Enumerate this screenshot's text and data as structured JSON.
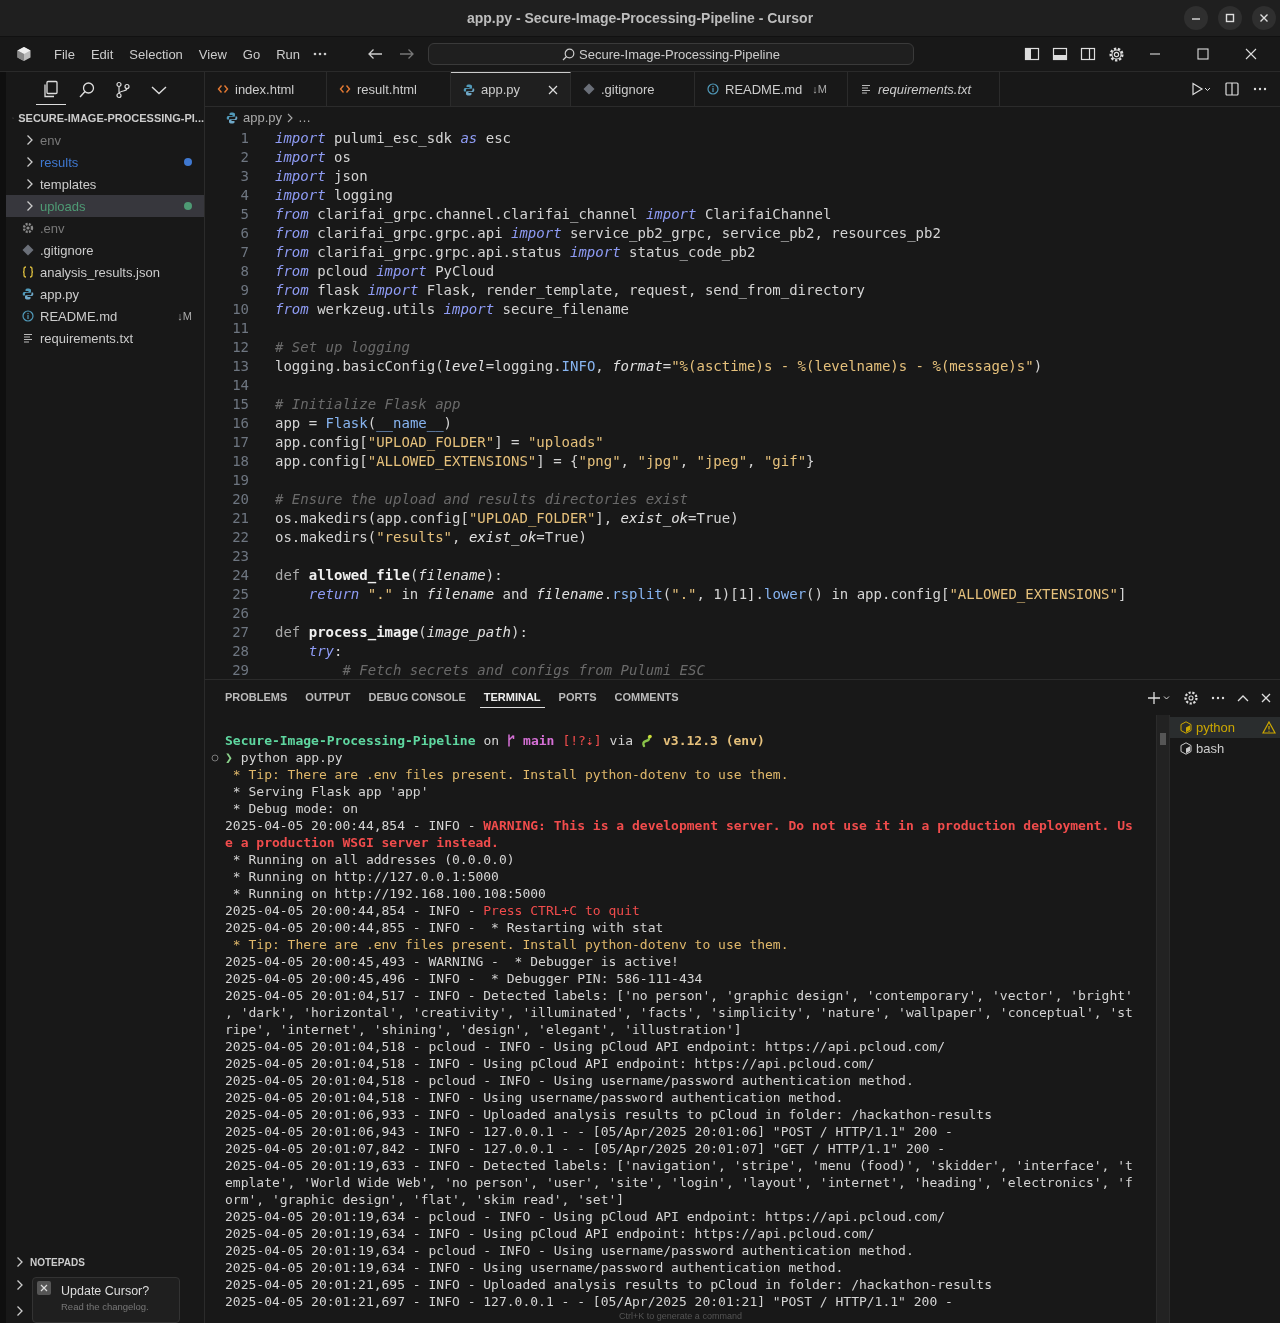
{
  "window": {
    "title": "app.py - Secure-Image-Processing-Pipeline - Cursor"
  },
  "menu": [
    "File",
    "Edit",
    "Selection",
    "View",
    "Go",
    "Run"
  ],
  "command_center": {
    "text": "Secure-Image-Processing-Pipeline"
  },
  "sidebar": {
    "title": "SECURE-IMAGE-PROCESSING-PI...",
    "tree": [
      {
        "label": "env",
        "kind": "folder",
        "ignored": true,
        "selected": false
      },
      {
        "label": "results",
        "kind": "folder",
        "ignored": false,
        "selected": false,
        "color": "#3f78d0"
      },
      {
        "label": "templates",
        "kind": "folder",
        "ignored": false,
        "selected": false
      },
      {
        "label": "uploads",
        "kind": "folder",
        "ignored": false,
        "selected": true,
        "color": "#4e9a74"
      },
      {
        "label": ".env",
        "kind": "config",
        "ignored": true,
        "selected": false
      },
      {
        "label": ".gitignore",
        "kind": "git",
        "ignored": false,
        "selected": false
      },
      {
        "label": "analysis_results.json",
        "kind": "json",
        "ignored": false,
        "selected": false
      },
      {
        "label": "app.py",
        "kind": "python",
        "ignored": false,
        "selected": false
      },
      {
        "label": "README.md",
        "kind": "info",
        "ignored": false,
        "selected": false,
        "badge": "↓M"
      },
      {
        "label": "requirements.txt",
        "kind": "text",
        "ignored": false,
        "selected": false
      }
    ],
    "sections": [
      "NOTEPADS"
    ]
  },
  "tabs": [
    {
      "label": "index.html",
      "kind": "html",
      "selected": false,
      "preview": false
    },
    {
      "label": "result.html",
      "kind": "html",
      "selected": false,
      "preview": false
    },
    {
      "label": "app.py",
      "kind": "python",
      "selected": true,
      "preview": false
    },
    {
      "label": ".gitignore",
      "kind": "git",
      "selected": false,
      "preview": false
    },
    {
      "label": "README.md",
      "kind": "info",
      "selected": false,
      "preview": false,
      "badge": "↓M"
    },
    {
      "label": "requirements.txt",
      "kind": "text",
      "selected": false,
      "preview": true
    }
  ],
  "breadcrumb": {
    "file": "app.py",
    "rest": "…"
  },
  "code": [
    {
      "num": "1",
      "tokens": [
        {
          "kind": "kw",
          "text": "import"
        },
        {
          "kind": "plain",
          "text": " pulumi_esc_sdk "
        },
        {
          "kind": "kw",
          "text": "as"
        },
        {
          "kind": "plain",
          "text": " esc"
        }
      ]
    },
    {
      "num": "2",
      "tokens": [
        {
          "kind": "kw",
          "text": "import"
        },
        {
          "kind": "plain",
          "text": " os"
        }
      ]
    },
    {
      "num": "3",
      "tokens": [
        {
          "kind": "kw",
          "text": "import"
        },
        {
          "kind": "plain",
          "text": " json"
        }
      ]
    },
    {
      "num": "4",
      "tokens": [
        {
          "kind": "kw",
          "text": "import"
        },
        {
          "kind": "plain",
          "text": " logging"
        }
      ]
    },
    {
      "num": "5",
      "tokens": [
        {
          "kind": "kw",
          "text": "from"
        },
        {
          "kind": "plain",
          "text": " clarifai_grpc.channel.clarifai_channel "
        },
        {
          "kind": "kw",
          "text": "import"
        },
        {
          "kind": "plain",
          "text": " ClarifaiChannel"
        }
      ]
    },
    {
      "num": "6",
      "tokens": [
        {
          "kind": "kw",
          "text": "from"
        },
        {
          "kind": "plain",
          "text": " clarifai_grpc.grpc.api "
        },
        {
          "kind": "kw",
          "text": "import"
        },
        {
          "kind": "plain",
          "text": " service_pb2_grpc, service_pb2, resources_pb2"
        }
      ]
    },
    {
      "num": "7",
      "tokens": [
        {
          "kind": "kw",
          "text": "from"
        },
        {
          "kind": "plain",
          "text": " clarifai_grpc.grpc.api.status "
        },
        {
          "kind": "kw",
          "text": "import"
        },
        {
          "kind": "plain",
          "text": " status_code_pb2"
        }
      ]
    },
    {
      "num": "8",
      "tokens": [
        {
          "kind": "kw",
          "text": "from"
        },
        {
          "kind": "plain",
          "text": " pcloud "
        },
        {
          "kind": "kw",
          "text": "import"
        },
        {
          "kind": "plain",
          "text": " PyCloud"
        }
      ]
    },
    {
      "num": "9",
      "tokens": [
        {
          "kind": "kw",
          "text": "from"
        },
        {
          "kind": "plain",
          "text": " flask "
        },
        {
          "kind": "kw",
          "text": "import"
        },
        {
          "kind": "plain",
          "text": " Flask, render_template, request, send_from_directory"
        }
      ]
    },
    {
      "num": "10",
      "tokens": [
        {
          "kind": "kw",
          "text": "from"
        },
        {
          "kind": "plain",
          "text": " werkzeug.utils "
        },
        {
          "kind": "kw",
          "text": "import"
        },
        {
          "kind": "plain",
          "text": " secure_filename"
        }
      ]
    },
    {
      "num": "11"
    },
    {
      "num": "12",
      "tokens": [
        {
          "kind": "comment",
          "text": "# Set up logging"
        }
      ]
    },
    {
      "num": "13",
      "tokens": [
        {
          "kind": "plain",
          "text": "logging.basicConfig("
        },
        {
          "kind": "param",
          "text": "level"
        },
        {
          "kind": "plain",
          "text": "=logging."
        },
        {
          "kind": "attr",
          "text": "INFO"
        },
        {
          "kind": "plain",
          "text": ", "
        },
        {
          "kind": "param",
          "text": "format"
        },
        {
          "kind": "plain",
          "text": "="
        },
        {
          "kind": "str",
          "text": "\"%(asctime)s - %(levelname)s - %(message)s\""
        },
        {
          "kind": "plain",
          "text": ")"
        }
      ]
    },
    {
      "num": "14"
    },
    {
      "num": "15",
      "tokens": [
        {
          "kind": "comment",
          "text": "# Initialize Flask app"
        }
      ]
    },
    {
      "num": "16",
      "tokens": [
        {
          "kind": "plain",
          "text": "app = "
        },
        {
          "kind": "attr",
          "text": "Flask"
        },
        {
          "kind": "plain",
          "text": "("
        },
        {
          "kind": "attr",
          "text": "__name__"
        },
        {
          "kind": "plain",
          "text": ")"
        }
      ]
    },
    {
      "num": "17",
      "tokens": [
        {
          "kind": "plain",
          "text": "app.config["
        },
        {
          "kind": "str",
          "text": "\"UPLOAD_FOLDER\""
        },
        {
          "kind": "plain",
          "text": "] = "
        },
        {
          "kind": "str",
          "text": "\"uploads\""
        }
      ]
    },
    {
      "num": "18",
      "tokens": [
        {
          "kind": "plain",
          "text": "app.config["
        },
        {
          "kind": "str",
          "text": "\"ALLOWED_EXTENSIONS\""
        },
        {
          "kind": "plain",
          "text": "] = {"
        },
        {
          "kind": "str",
          "text": "\"png\""
        },
        {
          "kind": "plain",
          "text": ", "
        },
        {
          "kind": "str",
          "text": "\"jpg\""
        },
        {
          "kind": "plain",
          "text": ", "
        },
        {
          "kind": "str",
          "text": "\"jpeg\""
        },
        {
          "kind": "plain",
          "text": ", "
        },
        {
          "kind": "str",
          "text": "\"gif\""
        },
        {
          "kind": "plain",
          "text": "}"
        }
      ]
    },
    {
      "num": "19"
    },
    {
      "num": "20",
      "tokens": [
        {
          "kind": "comment",
          "text": "# Ensure the upload and results directories exist"
        }
      ]
    },
    {
      "num": "21",
      "tokens": [
        {
          "kind": "plain",
          "text": "os.makedirs(app.config["
        },
        {
          "kind": "str",
          "text": "\"UPLOAD_FOLDER\""
        },
        {
          "kind": "plain",
          "text": "], "
        },
        {
          "kind": "param",
          "text": "exist_ok"
        },
        {
          "kind": "plain",
          "text": "=True)"
        }
      ]
    },
    {
      "num": "22",
      "tokens": [
        {
          "kind": "plain",
          "text": "os.makedirs("
        },
        {
          "kind": "str",
          "text": "\"results\""
        },
        {
          "kind": "plain",
          "text": ", "
        },
        {
          "kind": "param",
          "text": "exist_ok"
        },
        {
          "kind": "plain",
          "text": "=True)"
        }
      ]
    },
    {
      "num": "23"
    },
    {
      "num": "24",
      "tokens": [
        {
          "kind": "def",
          "text": "def "
        },
        {
          "kind": "fn",
          "text": "allowed_file"
        },
        {
          "kind": "plain",
          "text": "("
        },
        {
          "kind": "param",
          "text": "filename"
        },
        {
          "kind": "plain",
          "text": "):"
        }
      ]
    },
    {
      "num": "25",
      "tokens": [
        {
          "kind": "kw",
          "text": "    return"
        },
        {
          "kind": "str",
          "text": " \".\""
        },
        {
          "kind": "plain",
          "text": " in "
        },
        {
          "kind": "param",
          "text": "filename"
        },
        {
          "kind": "plain",
          "text": " and "
        },
        {
          "kind": "param",
          "text": "filename"
        },
        {
          "kind": "plain",
          "text": "."
        },
        {
          "kind": "attr",
          "text": "rsplit"
        },
        {
          "kind": "plain",
          "text": "("
        },
        {
          "kind": "str",
          "text": "\".\""
        },
        {
          "kind": "plain",
          "text": ", 1)[1]."
        },
        {
          "kind": "attr",
          "text": "lower"
        },
        {
          "kind": "plain",
          "text": "() in app.config["
        },
        {
          "kind": "str",
          "text": "\"ALLOWED_EXTENSIONS\""
        },
        {
          "kind": "plain",
          "text": "]"
        }
      ]
    },
    {
      "num": "26"
    },
    {
      "num": "27",
      "tokens": [
        {
          "kind": "def",
          "text": "def "
        },
        {
          "kind": "fn",
          "text": "process_image"
        },
        {
          "kind": "plain",
          "text": "("
        },
        {
          "kind": "param",
          "text": "image_path"
        },
        {
          "kind": "plain",
          "text": "):"
        }
      ]
    },
    {
      "num": "28",
      "tokens": [
        {
          "kind": "kw",
          "text": "    try"
        },
        {
          "kind": "plain",
          "text": ":"
        }
      ]
    },
    {
      "num": "29",
      "tokens": [
        {
          "kind": "comment",
          "text": "        # Fetch secrets and configs from Pulumi ESC"
        }
      ]
    }
  ],
  "panel": {
    "tabs": [
      {
        "label": "PROBLEMS",
        "selected": false
      },
      {
        "label": "OUTPUT",
        "selected": false
      },
      {
        "label": "DEBUG CONSOLE",
        "selected": false
      },
      {
        "label": "TERMINAL",
        "selected": true
      },
      {
        "label": "PORTS",
        "selected": false
      },
      {
        "label": "COMMENTS",
        "selected": false
      }
    ],
    "terminals": [
      {
        "label": "python",
        "selected": true,
        "warning": true
      },
      {
        "label": "bash",
        "selected": false,
        "warning": false
      }
    ],
    "hint": "Ctrl+K to generate a command"
  },
  "terminal": [
    {
      "kind": "prompt",
      "path": "Secure-Image-Processing-Pipeline",
      "on": "on",
      "branch": "main",
      "status": "[!?⇣]",
      "via": "via",
      "python": "v3.12.3 (env)"
    },
    {
      "kind": "command",
      "symbol": "❯",
      "text": "python app.py"
    },
    {
      "kind": "output",
      "segments": [
        {
          "kind": "tip",
          "text": " * Tip: There are .env files present. Install python-dotenv to use them."
        }
      ]
    },
    {
      "kind": "output",
      "segments": [
        {
          "kind": "out",
          "text": " * Serving Flask app 'app'"
        }
      ]
    },
    {
      "kind": "output",
      "segments": [
        {
          "kind": "out",
          "text": " * Debug mode: on"
        }
      ]
    },
    {
      "kind": "output",
      "segments": [
        {
          "kind": "out",
          "text": "2025-04-05 20:00:44,854 - INFO - "
        },
        {
          "kind": "alert",
          "text": "WARNING: This is a development server. Do not use it in a production deployment. Us"
        }
      ]
    },
    {
      "kind": "output",
      "segments": [
        {
          "kind": "alert",
          "text": "e a production WSGI server instead."
        }
      ]
    },
    {
      "kind": "output",
      "segments": [
        {
          "kind": "out",
          "text": " * Running on all addresses (0.0.0.0)"
        }
      ]
    },
    {
      "kind": "output",
      "segments": [
        {
          "kind": "out",
          "text": " * Running on http://127.0.0.1:5000"
        }
      ]
    },
    {
      "kind": "output",
      "segments": [
        {
          "kind": "out",
          "text": " * Running on http://192.168.100.108:5000"
        }
      ]
    },
    {
      "kind": "output",
      "segments": [
        {
          "kind": "out",
          "text": "2025-04-05 20:00:44,854 - INFO - "
        },
        {
          "kind": "red",
          "text": "Press CTRL+C to quit"
        }
      ]
    },
    {
      "kind": "output",
      "segments": [
        {
          "kind": "out",
          "text": "2025-04-05 20:00:44,855 - INFO -  * Restarting with stat"
        }
      ]
    },
    {
      "kind": "output",
      "segments": [
        {
          "kind": "tip",
          "text": " * Tip: There are .env files present. Install python-dotenv to use them."
        }
      ]
    },
    {
      "kind": "output",
      "segments": [
        {
          "kind": "out",
          "text": "2025-04-05 20:00:45,493 - WARNING -  * Debugger is active!"
        }
      ]
    },
    {
      "kind": "output",
      "segments": [
        {
          "kind": "out",
          "text": "2025-04-05 20:00:45,496 - INFO -  * Debugger PIN: 586-111-434"
        }
      ]
    },
    {
      "kind": "output",
      "segments": [
        {
          "kind": "out",
          "text": "2025-04-05 20:01:04,517 - INFO - Detected labels: ['no person', 'graphic design', 'contemporary', 'vector', 'bright'"
        }
      ]
    },
    {
      "kind": "output",
      "segments": [
        {
          "kind": "out",
          "text": ", 'dark', 'horizontal', 'creativity', 'illuminated', 'facts', 'simplicity', 'nature', 'wallpaper', 'conceptual', 'st"
        }
      ]
    },
    {
      "kind": "output",
      "segments": [
        {
          "kind": "out",
          "text": "ripe', 'internet', 'shining', 'design', 'elegant', 'illustration']"
        }
      ]
    },
    {
      "kind": "output",
      "segments": [
        {
          "kind": "out",
          "text": "2025-04-05 20:01:04,518 - pcloud - INFO - Using pCloud API endpoint: https://api.pcloud.com/"
        }
      ]
    },
    {
      "kind": "output",
      "segments": [
        {
          "kind": "out",
          "text": "2025-04-05 20:01:04,518 - INFO - Using pCloud API endpoint: https://api.pcloud.com/"
        }
      ]
    },
    {
      "kind": "output",
      "segments": [
        {
          "kind": "out",
          "text": "2025-04-05 20:01:04,518 - pcloud - INFO - Using username/password authentication method."
        }
      ]
    },
    {
      "kind": "output",
      "segments": [
        {
          "kind": "out",
          "text": "2025-04-05 20:01:04,518 - INFO - Using username/password authentication method."
        }
      ]
    },
    {
      "kind": "output",
      "segments": [
        {
          "kind": "out",
          "text": "2025-04-05 20:01:06,933 - INFO - Uploaded analysis results to pCloud in folder: /hackathon-results"
        }
      ]
    },
    {
      "kind": "output",
      "segments": [
        {
          "kind": "out",
          "text": "2025-04-05 20:01:06,943 - INFO - 127.0.0.1 - - [05/Apr/2025 20:01:06] \"POST / HTTP/1.1\" 200 -"
        }
      ]
    },
    {
      "kind": "output",
      "segments": [
        {
          "kind": "out",
          "text": "2025-04-05 20:01:07,842 - INFO - 127.0.0.1 - - [05/Apr/2025 20:01:07] \"GET / HTTP/1.1\" 200 -"
        }
      ]
    },
    {
      "kind": "output",
      "segments": [
        {
          "kind": "out",
          "text": "2025-04-05 20:01:19,633 - INFO - Detected labels: ['navigation', 'stripe', 'menu (food)', 'skidder', 'interface', 't"
        }
      ]
    },
    {
      "kind": "output",
      "segments": [
        {
          "kind": "out",
          "text": "emplate', 'World Wide Web', 'no person', 'user', 'site', 'login', 'layout', 'internet', 'heading', 'electronics', 'f"
        }
      ]
    },
    {
      "kind": "output",
      "segments": [
        {
          "kind": "out",
          "text": "orm', 'graphic design', 'flat', 'skim read', 'set']"
        }
      ]
    },
    {
      "kind": "output",
      "segments": [
        {
          "kind": "out",
          "text": "2025-04-05 20:01:19,634 - pcloud - INFO - Using pCloud API endpoint: https://api.pcloud.com/"
        }
      ]
    },
    {
      "kind": "output",
      "segments": [
        {
          "kind": "out",
          "text": "2025-04-05 20:01:19,634 - INFO - Using pCloud API endpoint: https://api.pcloud.com/"
        }
      ]
    },
    {
      "kind": "output",
      "segments": [
        {
          "kind": "out",
          "text": "2025-04-05 20:01:19,634 - pcloud - INFO - Using username/password authentication method."
        }
      ]
    },
    {
      "kind": "output",
      "segments": [
        {
          "kind": "out",
          "text": "2025-04-05 20:01:19,634 - INFO - Using username/password authentication method."
        }
      ]
    },
    {
      "kind": "output",
      "segments": [
        {
          "kind": "out",
          "text": "2025-04-05 20:01:21,695 - INFO - Uploaded analysis results to pCloud in folder: /hackathon-results"
        }
      ]
    },
    {
      "kind": "output",
      "segments": [
        {
          "kind": "out",
          "text": "2025-04-05 20:01:21,697 - INFO - 127.0.0.1 - - [05/Apr/2025 20:01:21] \"POST / HTTP/1.1\" 200 -"
        }
      ]
    }
  ],
  "notification": {
    "title": "Update Cursor?",
    "text": "Read the changelog."
  }
}
